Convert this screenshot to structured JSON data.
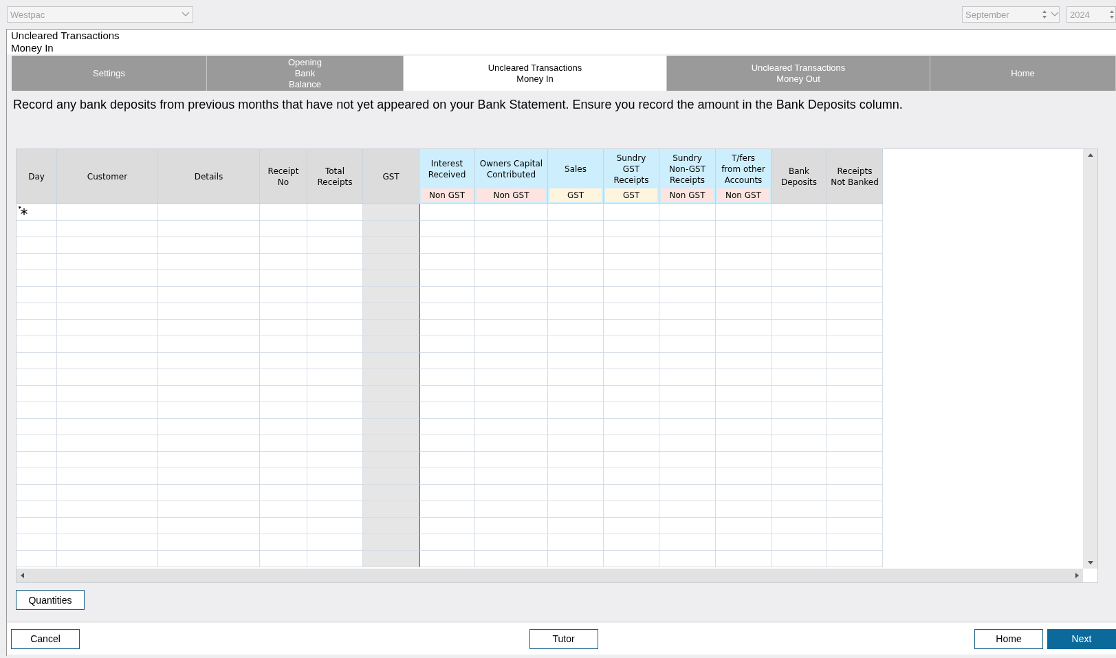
{
  "bank_select": {
    "value": "Westpac",
    "disabled": true
  },
  "month_spinner": {
    "value": "September",
    "disabled": true
  },
  "year_spinner": {
    "value": "2024",
    "disabled": true
  },
  "title_lines": [
    "Uncleared Transactions",
    "Money In"
  ],
  "tabs": [
    {
      "label": "Settings",
      "selected": false
    },
    {
      "label": "Opening\nBank\nBalance",
      "selected": false
    },
    {
      "label": "Uncleared Transactions\nMoney In",
      "selected": true
    },
    {
      "label": "Uncleared Transactions\nMoney Out",
      "selected": false
    },
    {
      "label": "Home",
      "selected": false
    }
  ],
  "instruction": "Record any bank deposits from previous months that have not yet appeared on your Bank Statement. Ensure you record the amount in the Bank Deposits column.",
  "grid": {
    "columns": [
      {
        "label": "Day",
        "kind": "plain",
        "readonly": false
      },
      {
        "label": "Customer",
        "kind": "plain",
        "readonly": false
      },
      {
        "label": "Details",
        "kind": "plain",
        "readonly": false
      },
      {
        "label": "Receipt\nNo",
        "kind": "plain",
        "readonly": false
      },
      {
        "label": "Total\nReceipts",
        "kind": "plain",
        "readonly": false
      },
      {
        "label": "GST",
        "kind": "plain",
        "readonly": true
      },
      {
        "label": "Interest\nReceived",
        "kind": "account",
        "readonly": false,
        "tag": {
          "label": "Non GST",
          "kind": "nongst"
        }
      },
      {
        "label": "Owners Capital\nContributed",
        "kind": "account",
        "readonly": false,
        "tag": {
          "label": "Non GST",
          "kind": "nongst"
        }
      },
      {
        "label": "Sales",
        "kind": "account",
        "readonly": false,
        "tag": {
          "label": "GST",
          "kind": "gst"
        }
      },
      {
        "label": "Sundry\nGST\nReceipts",
        "kind": "account",
        "readonly": false,
        "tag": {
          "label": "GST",
          "kind": "gst"
        }
      },
      {
        "label": "Sundry\nNon-GST\nReceipts",
        "kind": "account",
        "readonly": false,
        "tag": {
          "label": "Non GST",
          "kind": "nongst"
        }
      },
      {
        "label": "T/fers\nfrom other\nAccounts",
        "kind": "account",
        "readonly": false,
        "tag": {
          "label": "Non GST",
          "kind": "nongst"
        }
      },
      {
        "label": "Bank\nDeposits",
        "kind": "plain",
        "readonly": false
      },
      {
        "label": "Receipts\nNot Banked",
        "kind": "plain",
        "readonly": false
      }
    ]
  },
  "quantities_button": "Quantities",
  "footer_buttons": [
    {
      "label": "Cancel",
      "kind": "secondary"
    },
    {
      "label": "Tutor",
      "kind": "secondary"
    },
    {
      "label": "Home",
      "kind": "secondary"
    },
    {
      "label": "Next",
      "kind": "primary"
    }
  ]
}
